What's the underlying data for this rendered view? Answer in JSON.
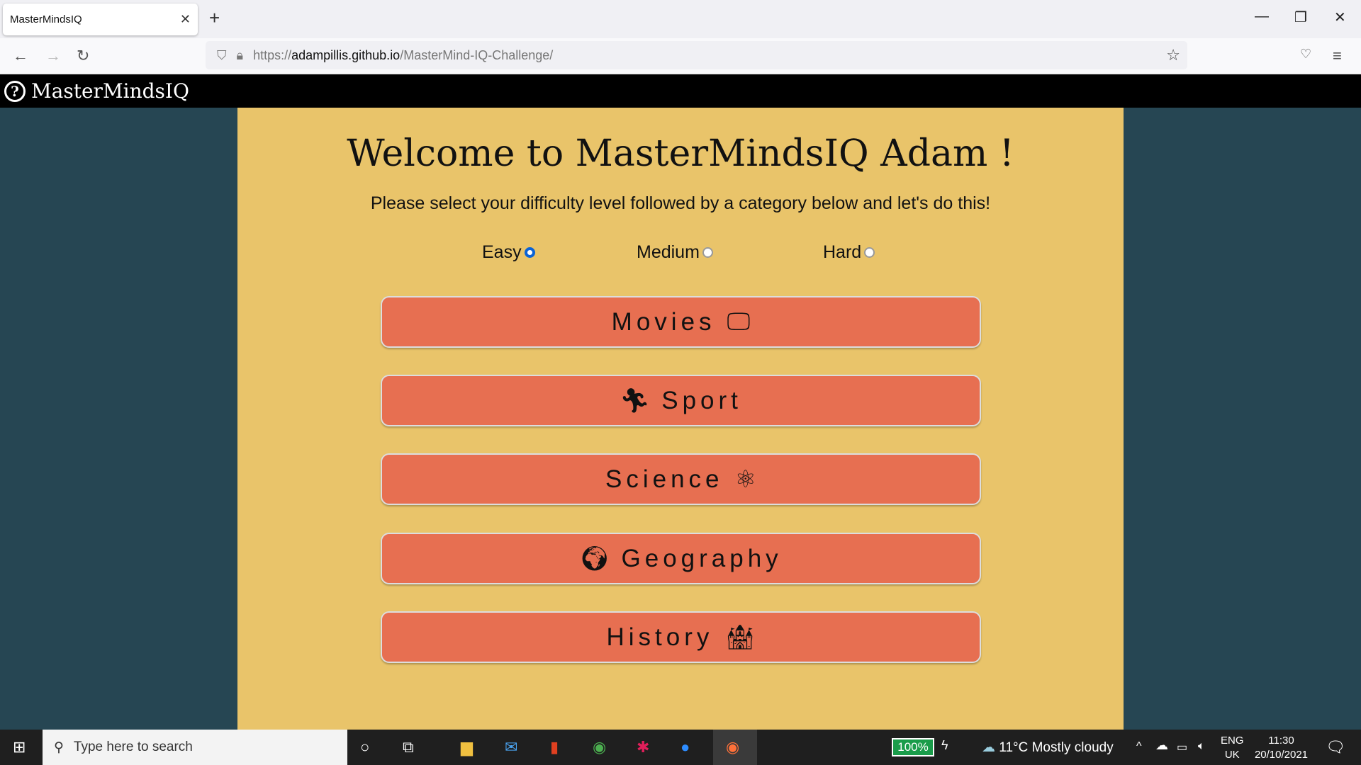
{
  "browser": {
    "tab_title": "MasterMindsIQ",
    "url_prefix": "https://",
    "url_host": "adampillis.github.io",
    "url_path": "/MasterMind-IQ-Challenge/"
  },
  "header": {
    "brand": "MasterMindsIQ",
    "icon": "question-circle-icon"
  },
  "main": {
    "title": "Welcome to MasterMindsIQ Adam !",
    "subtitle": "Please select your difficulty level followed by a category below and let's do this!",
    "difficulty": [
      {
        "label": "Easy",
        "selected": true
      },
      {
        "label": "Medium",
        "selected": false
      },
      {
        "label": "Hard",
        "selected": false
      }
    ],
    "categories": [
      {
        "label": "Movies",
        "icon": "tv-icon"
      },
      {
        "label": "Sport",
        "icon": "running-icon"
      },
      {
        "label": "Science",
        "icon": "atom-icon"
      },
      {
        "label": "Geography",
        "icon": "globe-icon"
      },
      {
        "label": "History",
        "icon": "castle-icon"
      }
    ]
  },
  "colors": {
    "background": "#264653",
    "panel": "#e9c46a",
    "button": "#e76f51",
    "header": "#000000"
  },
  "taskbar": {
    "search_placeholder": "Type here to search",
    "battery": "100%",
    "weather": "11°C  Mostly cloudy",
    "lang1": "ENG",
    "lang2": "UK",
    "time": "11:30",
    "date": "20/10/2021"
  }
}
